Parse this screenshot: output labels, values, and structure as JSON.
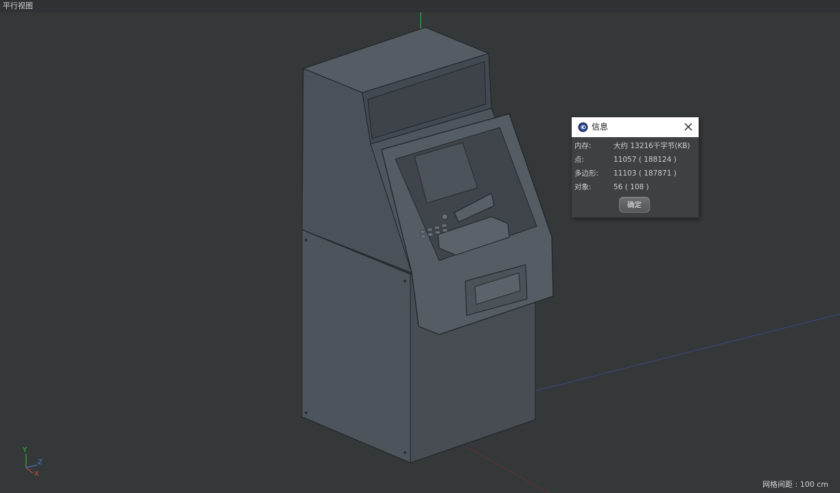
{
  "viewport": {
    "title": "平行视图",
    "grid_spacing": "网格间距 : 100 cm",
    "background_color": "#353839"
  },
  "axis_gizmo": {
    "y_label": "Y",
    "z_label": "Z",
    "x_label": "X",
    "y_color": "#3fbf3f",
    "z_color": "#4c7bd6",
    "x_color": "#d44a3a"
  },
  "scene": {
    "object": "atm-machine-model",
    "object_color": "#4d545b"
  },
  "info_dialog": {
    "title": "信息",
    "app_icon": "cinema4d-logo-icon",
    "close_icon": "close-icon",
    "rows": [
      {
        "label": "内存:",
        "value": "大约 13216千字节(KB)"
      },
      {
        "label": "点:",
        "value": "11057 ( 188124 )"
      },
      {
        "label": "多边形:",
        "value": "11103 ( 187871 )"
      },
      {
        "label": "对象:",
        "value": "56 ( 108 )"
      }
    ],
    "ok_label": "确定"
  }
}
